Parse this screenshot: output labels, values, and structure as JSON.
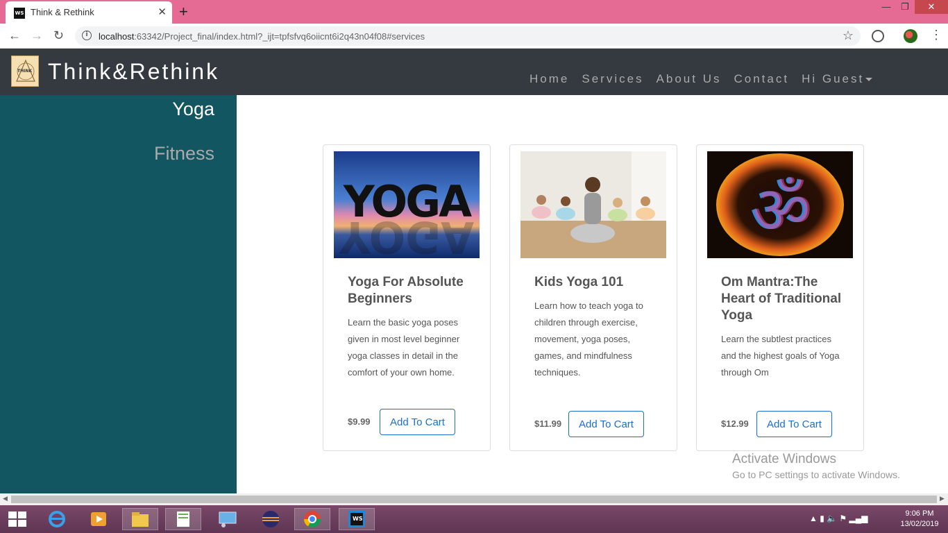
{
  "browser": {
    "tab_title": "Think & Rethink",
    "tab_favicon": "WS",
    "url_host": "localhost",
    "url_path": ":63342/Project_final/index.html?_ijt=tpfsfvq6oiicnt6i2q43n04f08#services"
  },
  "navbar": {
    "brand": "Think&Rethink",
    "logo_text": "THINK",
    "links": [
      "Home",
      "Services",
      "About Us",
      "Contact",
      "Hi Guest"
    ]
  },
  "sidebar": {
    "items": [
      "Yoga",
      "Fitness"
    ],
    "active": "Yoga"
  },
  "courses": [
    {
      "title": "Yoga For Absolute Beginners",
      "description": "Learn the basic yoga poses given in most level beginner yoga classes in detail in the comfort of your own home.",
      "price": "$9.99",
      "button": "Add To Cart",
      "image": "yoga-silhouette-sunset"
    },
    {
      "title": "Kids Yoga 101",
      "description": "Learn how to teach yoga to children through exercise, movement, yoga poses, games, and mindfulness techniques.",
      "price": "$11.99",
      "button": "Add To Cart",
      "image": "kids-yoga-class"
    },
    {
      "title": "Om Mantra:The Heart of Traditional Yoga",
      "description": "Learn the subtlest practices and the highest goals of Yoga through Om",
      "price": "$12.99",
      "button": "Add To Cart",
      "image": "om-symbol-fire"
    }
  ],
  "watermark": {
    "line1": "Activate Windows",
    "line2": "Go to PC settings to activate Windows."
  },
  "taskbar": {
    "time": "9:06 PM",
    "date": "13/02/2019",
    "apps": [
      "internet-explorer-icon",
      "media-player-icon",
      "file-explorer-icon",
      "notepad-plus-icon",
      "control-panel-icon",
      "eclipse-icon",
      "chrome-icon",
      "webstorm-icon"
    ]
  },
  "colors": {
    "tab_strip": "#e56b95",
    "navbar": "#343a40",
    "sidebar": "#115661",
    "button_accent": "#1a6fd0"
  }
}
